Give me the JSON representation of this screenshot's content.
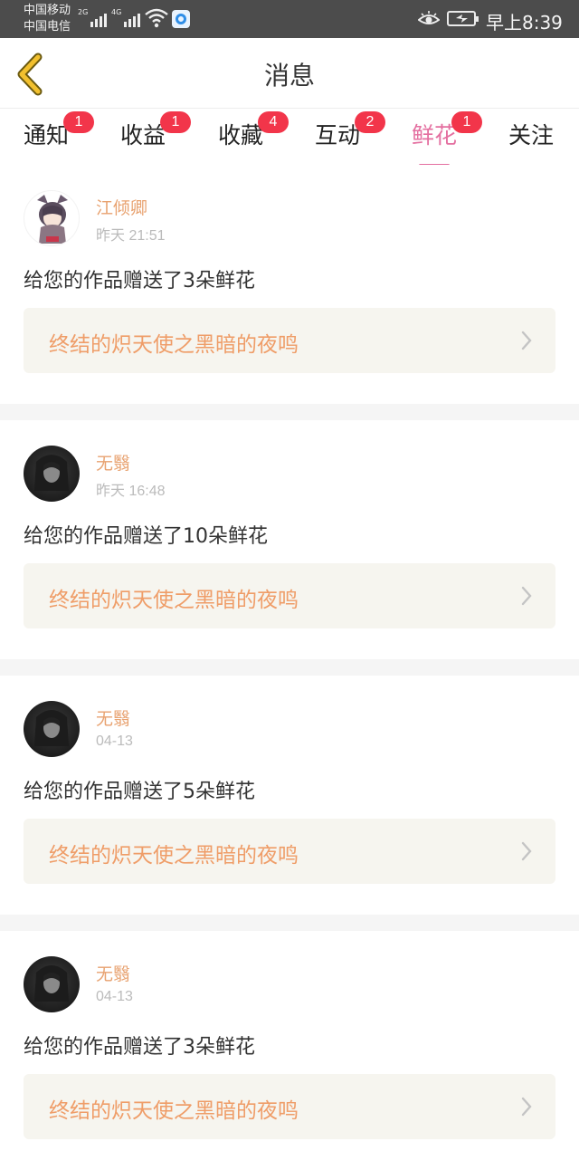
{
  "status_bar": {
    "carrier1": "中国移动",
    "carrier2": "中国电信",
    "net1": "2G",
    "net2": "4G",
    "time": "早上8:39"
  },
  "header": {
    "title": "消息"
  },
  "tabs": [
    {
      "label": "通知",
      "badge": "1"
    },
    {
      "label": "收益",
      "badge": "1"
    },
    {
      "label": "收藏",
      "badge": "4"
    },
    {
      "label": "互动",
      "badge": "2"
    },
    {
      "label": "鲜花",
      "badge": "1",
      "active": true
    },
    {
      "label": "关注",
      "badge": ""
    }
  ],
  "messages": [
    {
      "user": "江倾卿",
      "time": "昨天 21:51",
      "text": "给您的作品赠送了3朵鲜花",
      "work": "终结的炽天使之黑暗的夜鸣"
    },
    {
      "user": "无翳",
      "time": "昨天 16:48",
      "text": "给您的作品赠送了10朵鲜花",
      "work": "终结的炽天使之黑暗的夜鸣"
    },
    {
      "user": "无翳",
      "time": "04-13",
      "text": "给您的作品赠送了5朵鲜花",
      "work": "终结的炽天使之黑暗的夜鸣"
    },
    {
      "user": "无翳",
      "time": "04-13",
      "text": "给您的作品赠送了3朵鲜花",
      "work": "终结的炽天使之黑暗的夜鸣"
    }
  ],
  "colors": {
    "accent": "#e46fa0",
    "badge": "#f2354a",
    "username": "#e8a270",
    "work_title": "#ef9d68",
    "back_arrow": "#f2c02e"
  }
}
